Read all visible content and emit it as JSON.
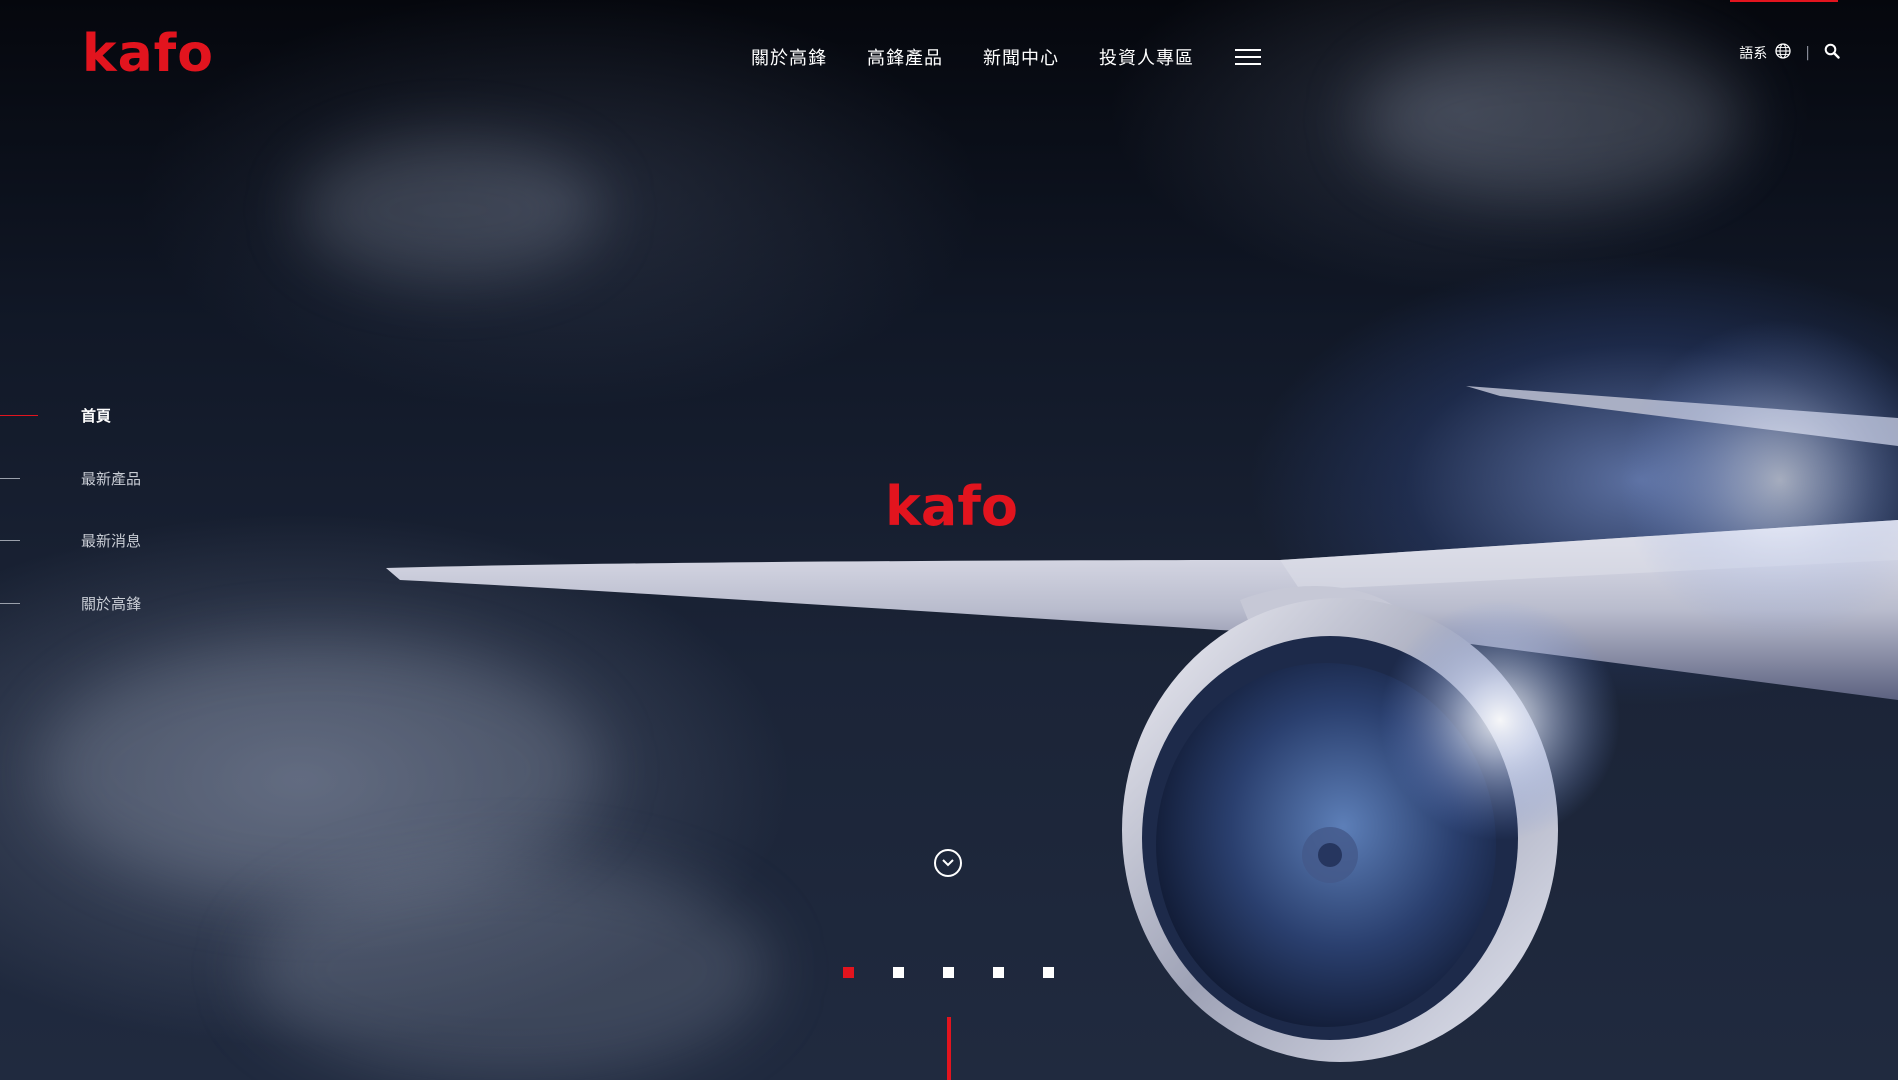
{
  "brand": {
    "logo_text": "kafo",
    "accent_color": "#e2141e"
  },
  "nav": {
    "items": [
      {
        "label": "關於高鋒"
      },
      {
        "label": "高鋒產品"
      },
      {
        "label": "新聞中心"
      },
      {
        "label": "投資人專區"
      }
    ],
    "menu_icon": "hamburger-menu-icon"
  },
  "top_right": {
    "language_label": "語系",
    "language_icon": "globe-icon",
    "separator": "|",
    "search_icon": "search-icon"
  },
  "side_nav": {
    "items": [
      {
        "label": "首頁",
        "active": true
      },
      {
        "label": "最新產品",
        "active": false
      },
      {
        "label": "最新消息",
        "active": false
      },
      {
        "label": "關於高鋒",
        "active": false
      }
    ]
  },
  "hero": {
    "center_logo_text": "kafo",
    "scroll_icon": "chevron-down-icon"
  },
  "pagination": {
    "total": 5,
    "active_index": 0
  }
}
